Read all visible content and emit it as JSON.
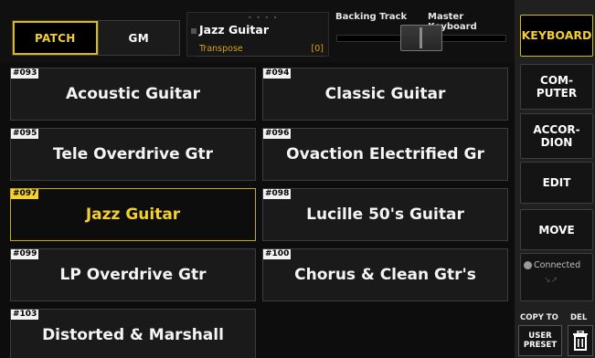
{
  "mode_tabs": {
    "patch": "PATCH",
    "gm": "GM"
  },
  "patch_info": {
    "dots": "• • • •",
    "name": "Jazz Guitar",
    "transpose_label": "Transpose",
    "transpose_value": "[0]"
  },
  "balance": {
    "left_label": "Backing Track",
    "right_label": "Master Keyboard",
    "level": 0.5
  },
  "patches": [
    {
      "num": "#093",
      "name": "Acoustic Guitar"
    },
    {
      "num": "#094",
      "name": "Classic Guitar"
    },
    {
      "num": "#095",
      "name": "Tele Overdrive Gtr"
    },
    {
      "num": "#096",
      "name": "Ovaction Electrified Gr"
    },
    {
      "num": "#097",
      "name": "Jazz Guitar"
    },
    {
      "num": "#098",
      "name": "Lucille 50's Guitar"
    },
    {
      "num": "#099",
      "name": "LP Overdrive Gtr"
    },
    {
      "num": "#100",
      "name": "Chorus & Clean Gtr's"
    },
    {
      "num": "#103",
      "name": "Distorted & Marshall"
    }
  ],
  "selected_patch": "#097",
  "right_panel": {
    "keyboard": "KEYBOARD",
    "computer_1": "COM-",
    "computer_2": "PUTER",
    "accordion_1": "ACCOR-",
    "accordion_2": "DION",
    "edit": "EDIT",
    "move": "MOVE",
    "status": "Connected",
    "copy_to": "COPY TO",
    "del": "DEL",
    "user_preset_1": "USER",
    "user_preset_2": "PRESET"
  },
  "colors": {
    "accent": "#f1cf35",
    "selected_border": "#c9a81b",
    "background": "#0d0d0d"
  }
}
